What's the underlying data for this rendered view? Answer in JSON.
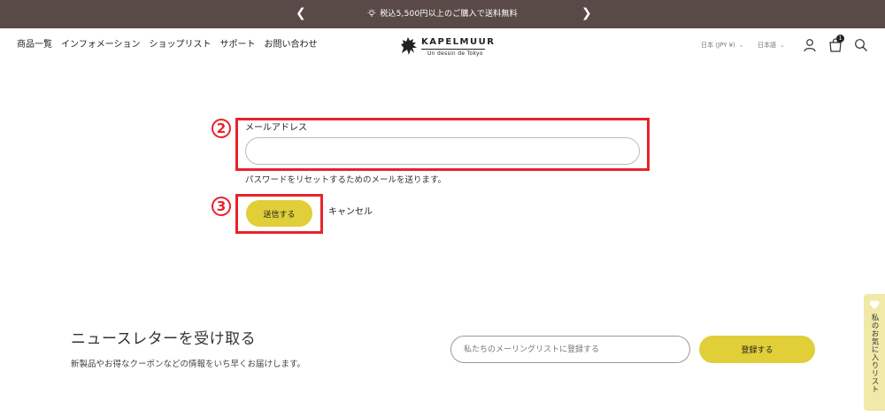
{
  "announcement": {
    "prev_icon": "chevron-left-icon",
    "next_icon": "chevron-right-icon",
    "message": "税込5,500円以上のご購入で送料無料"
  },
  "header": {
    "nav": [
      "商品一覧",
      "インフォメーション",
      "ショップリスト",
      "サポート",
      "お問い合わせ"
    ],
    "logo": {
      "brand": "KAPELMUUR",
      "tagline": "Un dessin de Tokyo"
    },
    "currency": "日本 (JPY ¥)",
    "language": "日本語",
    "cart_count": "1",
    "icons": [
      "user-icon",
      "cart-icon",
      "search-icon"
    ]
  },
  "form": {
    "step_email": "2",
    "step_submit": "3",
    "email_label": "メールアドレス",
    "email_value": "",
    "helper": "パスワードをリセットするためのメールを送ります。",
    "submit_label": "送信する",
    "cancel_label": "キャンセル"
  },
  "newsletter": {
    "title": "ニュースレターを受け取る",
    "description": "新製品やお得なクーポンなどの情報をいち早くお届けします。",
    "placeholder": "私たちのメーリングリストに登録する",
    "button": "登録する"
  },
  "wishlist": {
    "label": "私のお気に入りリスト"
  },
  "colors": {
    "announce_bg": "#5a4a47",
    "accent": "#e0cf38",
    "highlight": "#e8232b",
    "wishlist_bg": "#f1e9a8"
  }
}
